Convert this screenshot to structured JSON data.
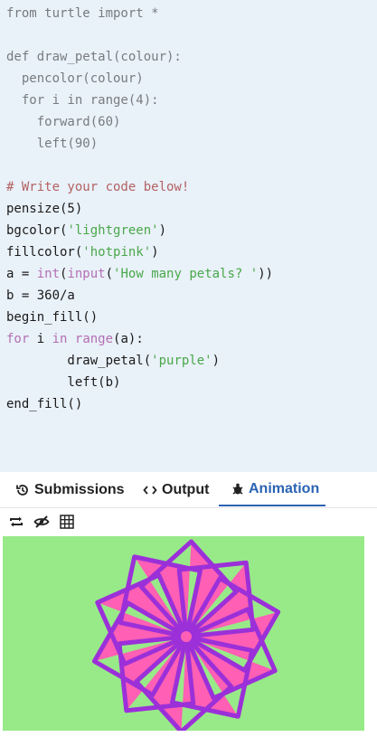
{
  "code": {
    "greyed": [
      [
        {
          "t": "from turtle import *",
          "c": "f"
        }
      ],
      [],
      [
        {
          "t": "def draw_petal(colour):",
          "c": "f"
        }
      ],
      [
        {
          "t": "  pencolor(colour)",
          "c": "f"
        }
      ],
      [
        {
          "t": "  for i in range(4):",
          "c": "f"
        }
      ],
      [
        {
          "t": "    forward(60)",
          "c": "f"
        }
      ],
      [
        {
          "t": "    left(90)",
          "c": "f"
        }
      ]
    ],
    "main": [
      [],
      [
        {
          "t": "# Write your code below!",
          "c": "c"
        }
      ],
      [
        {
          "t": "pensize(5)",
          "c": "f"
        }
      ],
      [
        {
          "t": "bgcolor(",
          "c": "f"
        },
        {
          "t": "'lightgreen'",
          "c": "s"
        },
        {
          "t": ")",
          "c": "f"
        }
      ],
      [
        {
          "t": "fillcolor(",
          "c": "f"
        },
        {
          "t": "'hotpink'",
          "c": "s"
        },
        {
          "t": ")",
          "c": "f"
        }
      ],
      [
        {
          "t": "a = ",
          "c": "f"
        },
        {
          "t": "int",
          "c": "k"
        },
        {
          "t": "(",
          "c": "f"
        },
        {
          "t": "input",
          "c": "k"
        },
        {
          "t": "(",
          "c": "f"
        },
        {
          "t": "'How many petals? '",
          "c": "s"
        },
        {
          "t": "))",
          "c": "f"
        }
      ],
      [
        {
          "t": "b = 360/a",
          "c": "f"
        }
      ],
      [
        {
          "t": "begin_fill()",
          "c": "f"
        }
      ],
      [
        {
          "t": "for",
          "c": "k"
        },
        {
          "t": " i ",
          "c": "f"
        },
        {
          "t": "in",
          "c": "k"
        },
        {
          "t": " ",
          "c": "f"
        },
        {
          "t": "range",
          "c": "k"
        },
        {
          "t": "(a):",
          "c": "f"
        }
      ],
      [
        {
          "t": "        draw_petal(",
          "c": "f"
        },
        {
          "t": "'purple'",
          "c": "s"
        },
        {
          "t": ")",
          "c": "f"
        }
      ],
      [
        {
          "t": "        left(b)",
          "c": "f"
        }
      ],
      [
        {
          "t": "end_fill()",
          "c": "f"
        }
      ]
    ]
  },
  "tabs": {
    "submissions": "Submissions",
    "output": "Output",
    "animation": "Animation"
  },
  "toolbar": {
    "icons": [
      "repeat-icon",
      "eye-slash-icon",
      "grid-icon"
    ]
  },
  "drawing": {
    "petals": 10,
    "petal_side": 60,
    "pen_color": "#9b30d9",
    "fill_color": "#ff5fb4",
    "background": "#98ea88"
  }
}
